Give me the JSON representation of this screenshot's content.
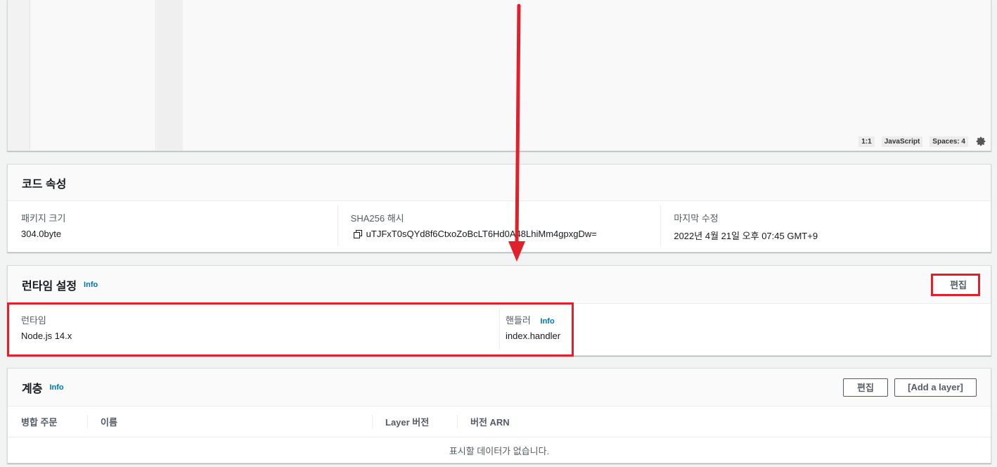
{
  "editor": {
    "status": {
      "position": "1:1",
      "language": "JavaScript",
      "indent": "Spaces: 4"
    }
  },
  "code_properties": {
    "title": "코드 속성",
    "package_size_label": "패키지 크기",
    "package_size_value": "304.0byte",
    "sha_label": "SHA256 해시",
    "sha_value": "uTJFxT0sQYd8f6CtxoZoBcLT6Hd0A48LhiMm4gpxgDw=",
    "modified_label": "마지막 수정",
    "modified_value": "2022년 4월 21일 오후 07:45 GMT+9"
  },
  "runtime_settings": {
    "title": "런타임 설정",
    "info": "Info",
    "edit_label": "편집",
    "runtime_label": "런타임",
    "runtime_value": "Node.js 14.x",
    "handler_label": "핸들러",
    "handler_info": "Info",
    "handler_value": "index.handler"
  },
  "layers": {
    "title": "계층",
    "info": "Info",
    "edit_label": "편집",
    "add_label": "[Add a layer]",
    "columns": [
      "병합 주문",
      "이름",
      "Layer 버전",
      "버전 ARN"
    ],
    "empty_message": "표시할 데이터가 없습니다."
  },
  "colors": {
    "annotation_red": "#e0202a",
    "link_blue": "#0073bb"
  }
}
